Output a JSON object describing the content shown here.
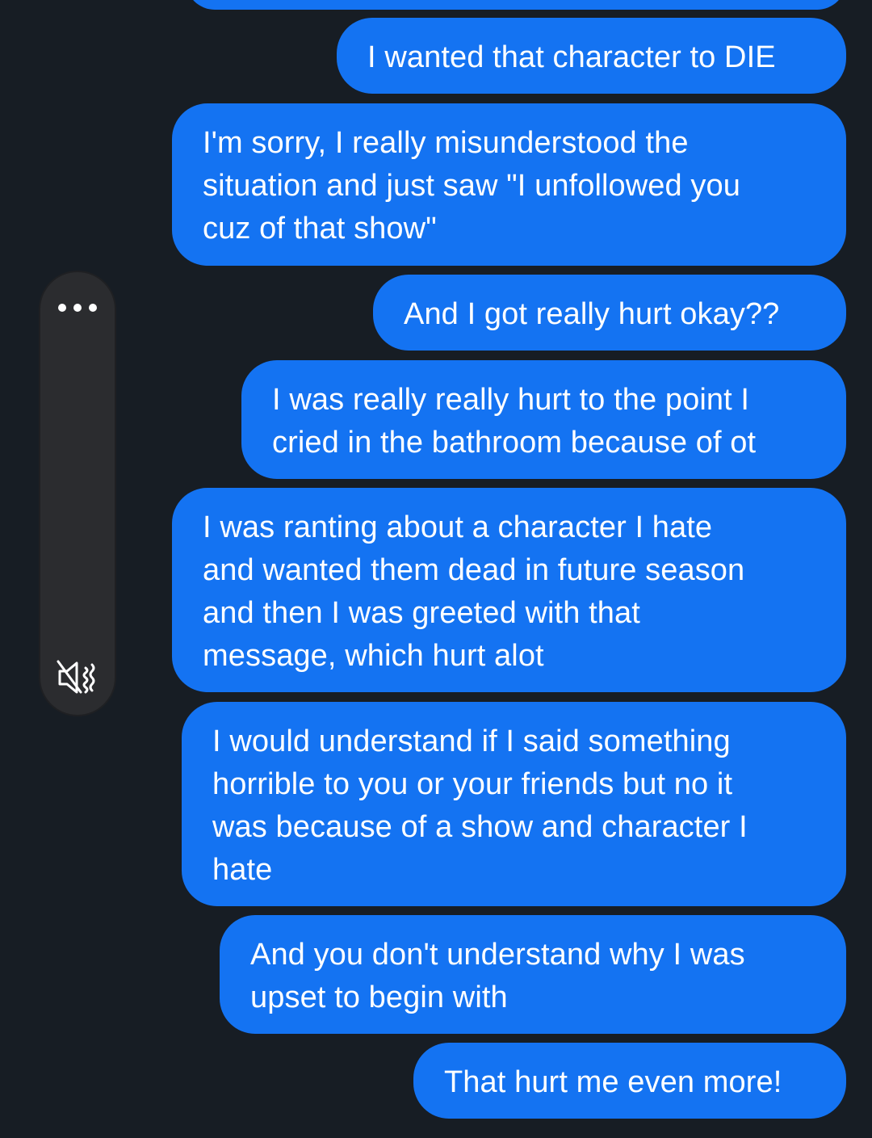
{
  "messages": [
    {
      "text": "I wanted that character to DIE"
    },
    {
      "text": "I'm sorry, I really misunderstood the\nsituation and just saw \"I unfollowed you\ncuz of that show\""
    },
    {
      "text": "And I got really hurt okay??"
    },
    {
      "text": "I was really really hurt to the point I\ncried in the bathroom because of ot"
    },
    {
      "text": "I was ranting about a character I hate\nand wanted them dead in future season\nand then I was greeted with that\nmessage, which hurt alot"
    },
    {
      "text": "I would understand if I said something\nhorrible to you or your friends but no it\nwas because of a show and character I\nhate"
    },
    {
      "text": "And you don't understand why I was\nupset to begin with"
    },
    {
      "text": "That hurt me even more!"
    }
  ],
  "volume_panel": {
    "icons": [
      "more-dots-icon",
      "volume-mute-icon"
    ]
  },
  "colors": {
    "background": "#171d24",
    "bubble": "#1473f2",
    "text": "#ffffff",
    "panel": "#2b2c2f"
  }
}
